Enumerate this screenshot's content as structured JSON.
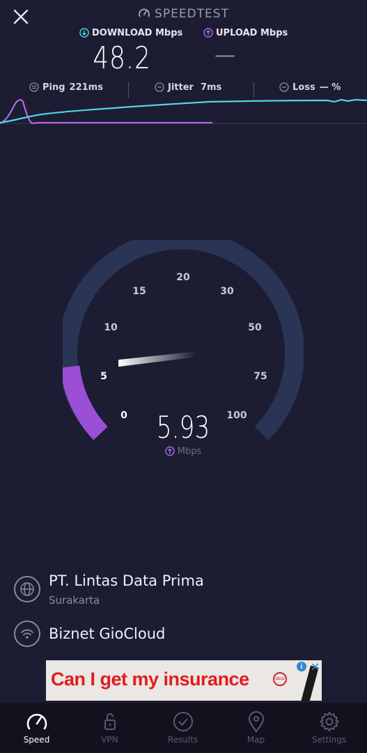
{
  "header": {
    "title": "SPEEDTEST",
    "close_icon": "close-icon"
  },
  "metrics": {
    "download": {
      "label": "DOWNLOAD Mbps",
      "value": "48.2",
      "color": "#4fd7e0"
    },
    "upload": {
      "label": "UPLOAD Mbps",
      "value": "—",
      "color": "#b169e6"
    }
  },
  "stats": {
    "ping": {
      "label": "Ping",
      "value": "221ms"
    },
    "jitter": {
      "label": "Jitter",
      "value": "7ms"
    },
    "loss": {
      "label": "Loss",
      "value": "— %"
    }
  },
  "gauge": {
    "ticks": [
      "0",
      "5",
      "10",
      "15",
      "20",
      "30",
      "50",
      "75",
      "100"
    ],
    "value": "5.93",
    "unit": "Mbps",
    "fill_color": "#9b4fd6",
    "track_color": "#2a3454"
  },
  "server": {
    "provider": "PT. Lintas Data Prima",
    "location": "Surakarta"
  },
  "network": {
    "name": "Biznet GioCloud"
  },
  "ad": {
    "text": "Can I get my insurance",
    "logo_text": "absa"
  },
  "tabs": [
    {
      "label": "Speed",
      "icon": "speedometer-icon",
      "active": true
    },
    {
      "label": "VPN",
      "icon": "lock-icon",
      "active": false
    },
    {
      "label": "Results",
      "icon": "checkmark-icon",
      "active": false
    },
    {
      "label": "Map",
      "icon": "map-pin-icon",
      "active": false
    },
    {
      "label": "Settings",
      "icon": "gear-icon",
      "active": false
    }
  ]
}
